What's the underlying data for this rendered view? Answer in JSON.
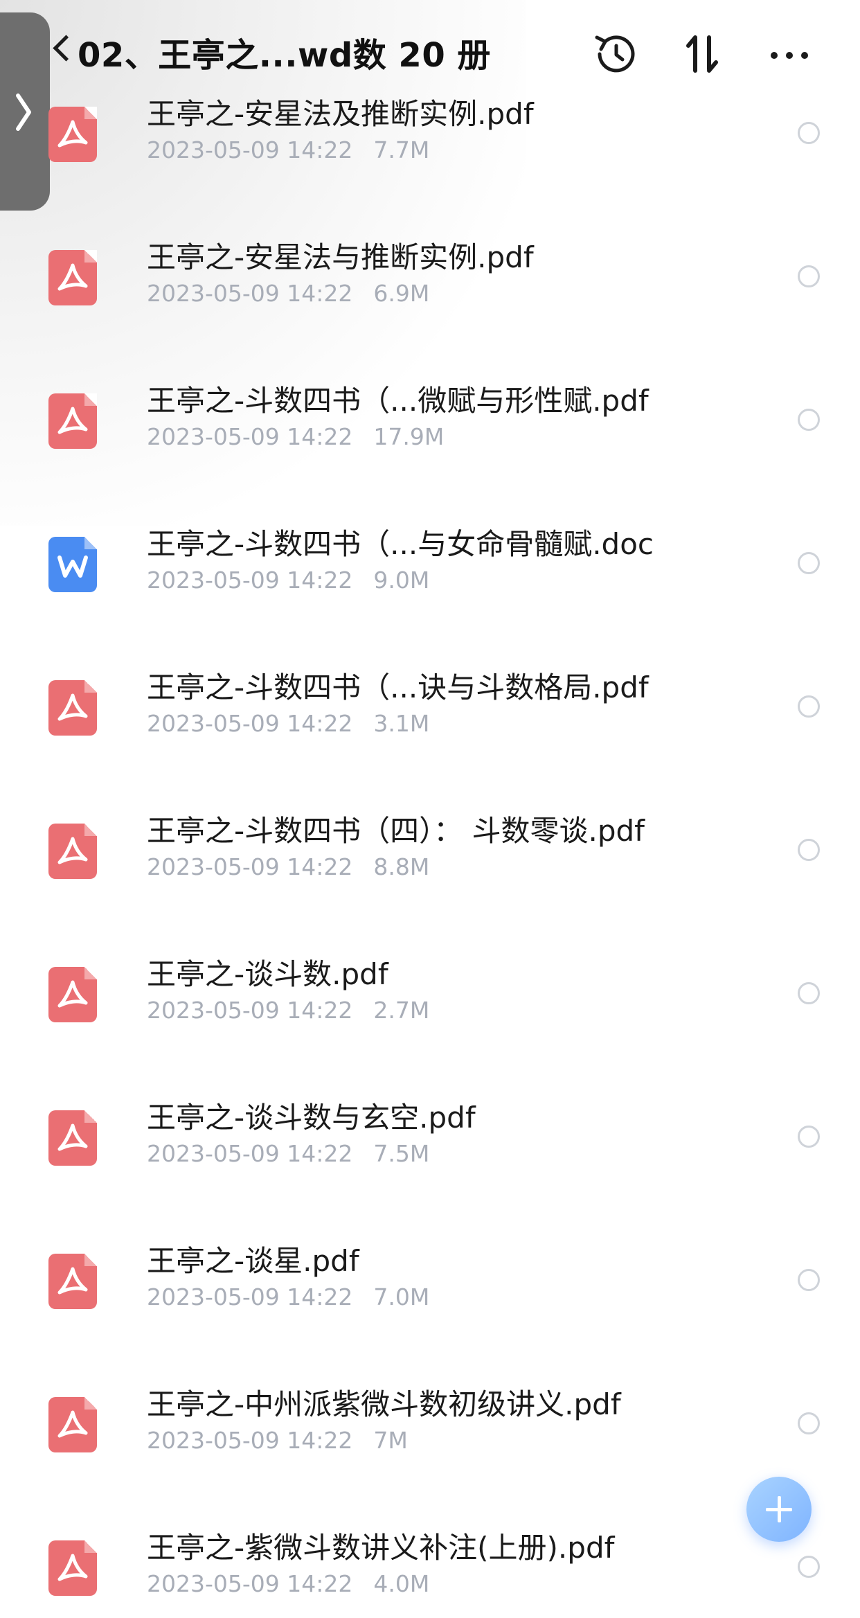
{
  "header": {
    "title": "02、王亭之...wd数 20 册",
    "icons": [
      "history-icon",
      "sort-icon",
      "more-icon"
    ]
  },
  "side_tab": {
    "icon": "chevron-right-icon"
  },
  "files": [
    {
      "name": "王亭之-安星法及推断实例.pdf",
      "date": "2023-05-09 14:22",
      "size": "7.7M",
      "type": "pdf"
    },
    {
      "name": "王亭之-安星法与推断实例.pdf",
      "date": "2023-05-09 14:22",
      "size": "6.9M",
      "type": "pdf"
    },
    {
      "name": "王亭之-斗数四书（...微赋与形性赋.pdf",
      "date": "2023-05-09 14:22",
      "size": "17.9M",
      "type": "pdf"
    },
    {
      "name": "王亭之-斗数四书（...与女命骨髓赋.doc",
      "date": "2023-05-09 14:22",
      "size": "9.0M",
      "type": "doc"
    },
    {
      "name": "王亭之-斗数四书（...诀与斗数格局.pdf",
      "date": "2023-05-09 14:22",
      "size": "3.1M",
      "type": "pdf"
    },
    {
      "name": "王亭之-斗数四书（四）： 斗数零谈.pdf",
      "date": "2023-05-09 14:22",
      "size": "8.8M",
      "type": "pdf"
    },
    {
      "name": "王亭之-谈斗数.pdf",
      "date": "2023-05-09 14:22",
      "size": "2.7M",
      "type": "pdf"
    },
    {
      "name": "王亭之-谈斗数与玄空.pdf",
      "date": "2023-05-09 14:22",
      "size": "7.5M",
      "type": "pdf"
    },
    {
      "name": "王亭之-谈星.pdf",
      "date": "2023-05-09 14:22",
      "size": "7.0M",
      "type": "pdf"
    },
    {
      "name": "王亭之-中州派紫微斗数初级讲义.pdf",
      "date": "2023-05-09 14:22",
      "size": "7M",
      "type": "pdf"
    },
    {
      "name": "王亭之-紫微斗数讲义补注(上册).pdf",
      "date": "2023-05-09 14:22",
      "size": "4.0M",
      "type": "pdf"
    }
  ],
  "fab": {
    "icon": "plus-icon"
  },
  "colors": {
    "pdf": "#ea6f73",
    "doc": "#4a8cf2",
    "meta_text": "#a8adb7",
    "fab": "#8fc1ff"
  }
}
